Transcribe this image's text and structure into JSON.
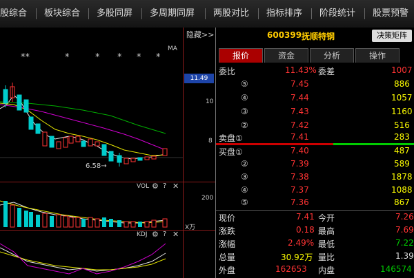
{
  "menu": [
    "股综合",
    "板块综合",
    "多股同屏",
    "多周期同屏",
    "两股对比",
    "指标排序",
    "阶段统计",
    "股票预警"
  ],
  "chart": {
    "hide_label": "隐藏>>",
    "ma_label": "MA",
    "stars": [
      "**",
      "*",
      "*",
      "*",
      "*",
      "*"
    ],
    "price_labels": [
      "10",
      "8"
    ],
    "current_price": "11.49",
    "low_label": "6.58→",
    "vol_title": "VOL",
    "vol_scale": "200",
    "vol_unit": "X万",
    "kdj_title": "KDJ"
  },
  "panel": {
    "code": "600399",
    "name": "抚顺特钢",
    "decision_button": "决策矩阵",
    "tabs": [
      "报价",
      "资金",
      "分析",
      "操作"
    ],
    "weibi": {
      "label": "委比",
      "value": "11.43%",
      "label2": "委差",
      "value2": "1007"
    },
    "sell_label": "卖盘①",
    "buy_label": "买盘①",
    "sell": [
      {
        "level": "⑤",
        "price": "7.45",
        "vol": "886"
      },
      {
        "level": "④",
        "price": "7.44",
        "vol": "1057"
      },
      {
        "level": "③",
        "price": "7.43",
        "vol": "1160"
      },
      {
        "level": "②",
        "price": "7.42",
        "vol": "516"
      },
      {
        "level": "①",
        "price": "7.41",
        "vol": "283"
      }
    ],
    "buy": [
      {
        "level": "①",
        "price": "7.40",
        "vol": "487"
      },
      {
        "level": "②",
        "price": "7.39",
        "vol": "589"
      },
      {
        "level": "③",
        "price": "7.38",
        "vol": "1878"
      },
      {
        "level": "④",
        "price": "7.37",
        "vol": "1088"
      },
      {
        "level": "⑤",
        "price": "7.36",
        "vol": "867"
      }
    ],
    "stats": [
      {
        "l1": "现价",
        "v1": "7.41",
        "l2": "今开",
        "v2": "7.26"
      },
      {
        "l1": "涨跌",
        "v1": "0.18",
        "l2": "最高",
        "v2": "7.69"
      },
      {
        "l1": "涨幅",
        "v1": "2.49%",
        "l2": "最低",
        "v2": "7.22"
      },
      {
        "l1": "总量",
        "v1": "30.92万",
        "l2": "量比",
        "v2": "1.39"
      },
      {
        "l1": "外盘",
        "v1": "162653",
        "l2": "内盘",
        "v2": "146574"
      }
    ]
  }
}
